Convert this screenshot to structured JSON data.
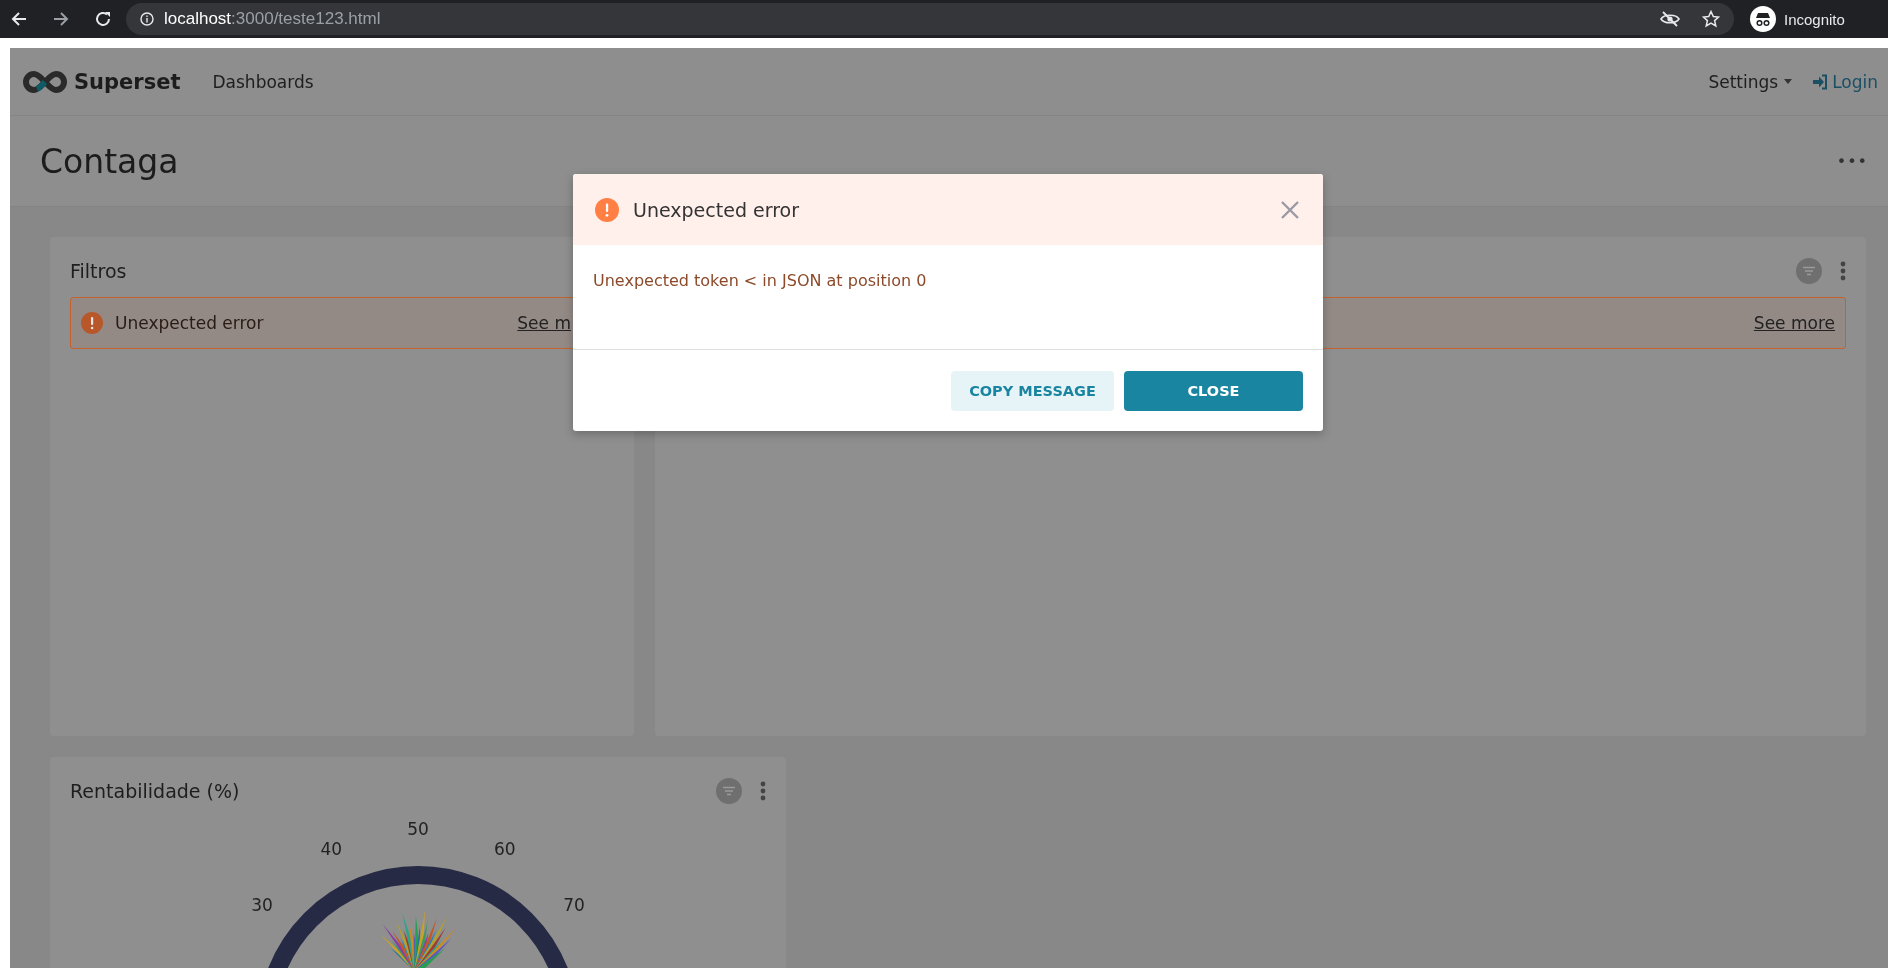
{
  "browser": {
    "url_host": "localhost",
    "url_path": ":3000/teste123.html",
    "profile": "Incognito"
  },
  "navbar": {
    "brand": "Superset",
    "links": [
      "Dashboards"
    ],
    "settings": "Settings",
    "login": "Login"
  },
  "dashboard": {
    "title": "Contaga",
    "menu": "•••"
  },
  "charts": [
    {
      "title": "Filtros",
      "show_actions": false,
      "alert": {
        "message": "Unexpected error",
        "link": "See m"
      }
    },
    {
      "show_actions": true,
      "alert": {
        "link": "See more"
      }
    },
    {
      "title": "Rentabilidade (%)",
      "show_actions": true,
      "gauge_ticks": [
        "30",
        "40",
        "50",
        "60",
        "70"
      ]
    }
  ],
  "modal": {
    "title": "Unexpected error",
    "message": "Unexpected token < in JSON at position 0",
    "buttons": [
      {
        "label": "COPY MESSAGE",
        "kind": "secondary"
      },
      {
        "label": "CLOSE",
        "kind": "primary"
      }
    ]
  }
}
